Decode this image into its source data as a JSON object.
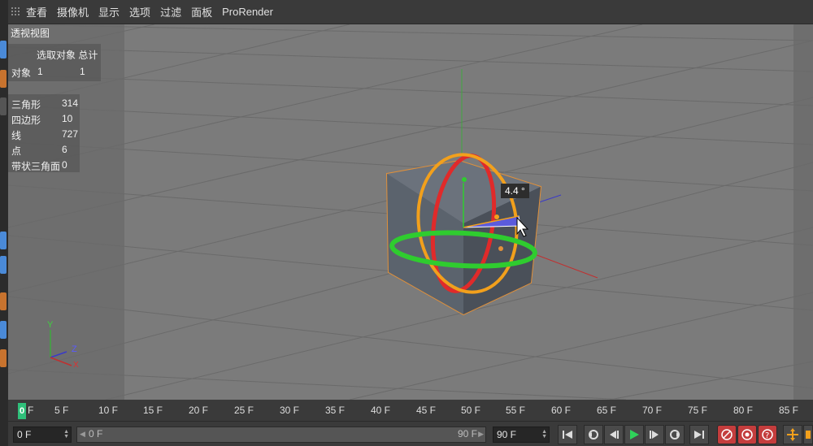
{
  "menu": {
    "items": [
      "查看",
      "摄像机",
      "显示",
      "选项",
      "过滤",
      "面板",
      "ProRender"
    ]
  },
  "viewport": {
    "title": "透视视图",
    "angle_label": "4.4 °",
    "hud_selection": {
      "header": "选取对象 总计",
      "row_label": "对象",
      "selected": "1",
      "total": "1"
    },
    "hud_stats": [
      {
        "label": "三角形",
        "value": "314"
      },
      {
        "label": "四边形",
        "value": "10"
      },
      {
        "label": "线",
        "value": "727"
      },
      {
        "label": "点",
        "value": "6"
      },
      {
        "label": "带状三角面",
        "value": "0"
      }
    ],
    "axis_labels": {
      "y": "Y",
      "z": "Z",
      "x": "X"
    }
  },
  "timeline": {
    "current_frame": "0",
    "current_frame_unit": "F",
    "ticks": [
      "5 F",
      "10 F",
      "15 F",
      "20 F",
      "25 F",
      "30 F",
      "35 F",
      "40 F",
      "45 F",
      "50 F",
      "55 F",
      "60 F",
      "65 F",
      "70 F",
      "75 F",
      "80 F",
      "85 F"
    ]
  },
  "transport": {
    "current_field": "0 F",
    "range_start": "0 F",
    "range_end": "90 F",
    "end_field": "90 F"
  },
  "colors": {
    "play": "#2fd25a",
    "ring_red": "#e02a2a",
    "ring_green": "#2fcc2f",
    "ring_orange": "#f2a01c",
    "outline_orange": "#e0903a"
  }
}
